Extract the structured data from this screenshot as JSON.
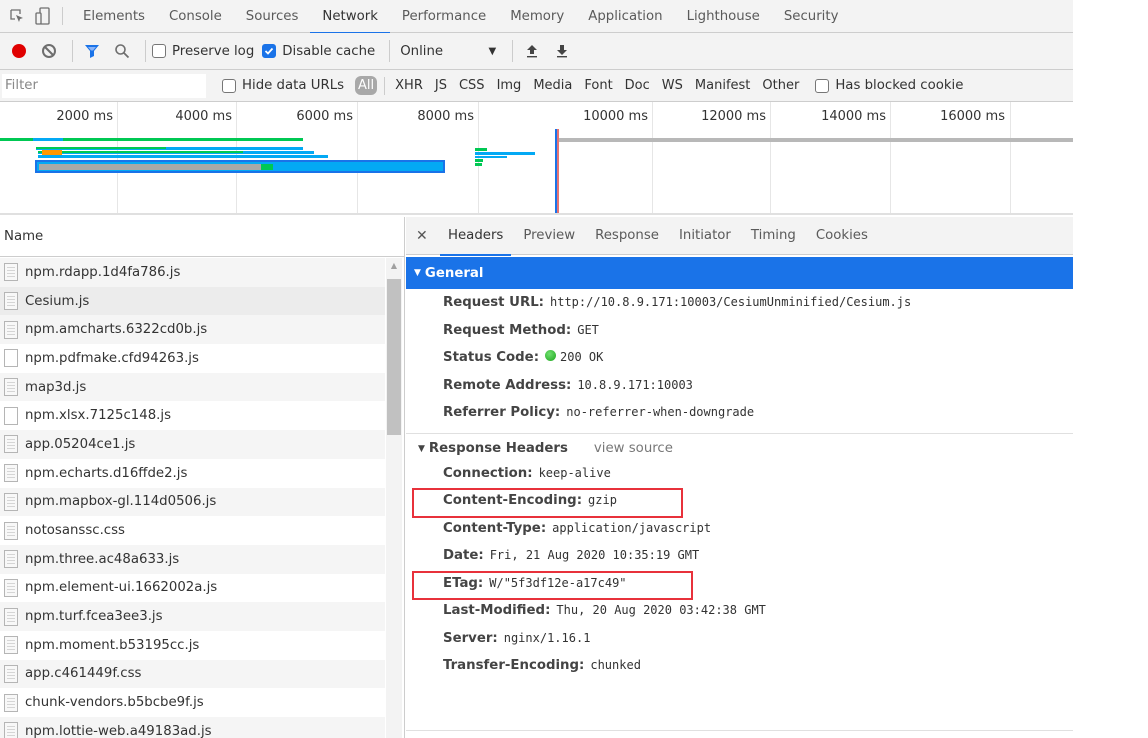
{
  "tabbar": {
    "tabs": [
      {
        "label": "Elements",
        "active": false
      },
      {
        "label": "Console",
        "active": false
      },
      {
        "label": "Sources",
        "active": false
      },
      {
        "label": "Network",
        "active": true
      },
      {
        "label": "Performance",
        "active": false
      },
      {
        "label": "Memory",
        "active": false
      },
      {
        "label": "Application",
        "active": false
      },
      {
        "label": "Lighthouse",
        "active": false
      },
      {
        "label": "Security",
        "active": false
      }
    ],
    "icons": [
      "inspect-element-icon",
      "device-toolbar-icon"
    ]
  },
  "toolbar": {
    "record_color": "#e00000",
    "preserve_log": {
      "label": "Preserve log",
      "checked": false
    },
    "disable_cache": {
      "label": "Disable cache",
      "checked": true
    },
    "throttling": "Online",
    "upload_icon": "import-har-icon",
    "download_icon": "export-har-icon"
  },
  "filterbar": {
    "placeholder": "Filter",
    "hide_data_urls": {
      "label": "Hide data URLs",
      "checked": false
    },
    "types": [
      "All",
      "XHR",
      "JS",
      "CSS",
      "Img",
      "Media",
      "Font",
      "Doc",
      "WS",
      "Manifest",
      "Other"
    ],
    "active_type": "All",
    "blocked_cookies": {
      "label": "Has blocked cookie",
      "checked": false
    }
  },
  "overview": {
    "ticks": [
      "2000 ms",
      "4000 ms",
      "6000 ms",
      "8000 ms",
      "10000 ms",
      "12000 ms",
      "14000 ms",
      "16000 ms"
    ],
    "colors": {
      "waiting": "#00c853",
      "download": "#03a9f4",
      "queued": "#a0a0a0",
      "stalled": "#ff9800",
      "dom_content_loaded": "#1a73e8",
      "load": "#e57373"
    }
  },
  "request_list": {
    "header": "Name",
    "rows": [
      {
        "name": "npm.rdapp.1d4fa786.js",
        "icon": "script",
        "selected": false
      },
      {
        "name": "Cesium.js",
        "icon": "script",
        "selected": true
      },
      {
        "name": "npm.amcharts.6322cd0b.js",
        "icon": "script",
        "selected": false
      },
      {
        "name": "npm.pdfmake.cfd94263.js",
        "icon": "blank",
        "selected": false
      },
      {
        "name": "map3d.js",
        "icon": "script",
        "selected": false
      },
      {
        "name": "npm.xlsx.7125c148.js",
        "icon": "blank",
        "selected": false
      },
      {
        "name": "app.05204ce1.js",
        "icon": "script",
        "selected": false
      },
      {
        "name": "npm.echarts.d16ffde2.js",
        "icon": "script",
        "selected": false
      },
      {
        "name": "npm.mapbox-gl.114d0506.js",
        "icon": "script",
        "selected": false
      },
      {
        "name": "notosanssc.css",
        "icon": "script",
        "selected": false
      },
      {
        "name": "npm.three.ac48a633.js",
        "icon": "script",
        "selected": false
      },
      {
        "name": "npm.element-ui.1662002a.js",
        "icon": "script",
        "selected": false
      },
      {
        "name": "npm.turf.fcea3ee3.js",
        "icon": "script",
        "selected": false
      },
      {
        "name": "npm.moment.b53195cc.js",
        "icon": "script",
        "selected": false
      },
      {
        "name": "app.c461449f.css",
        "icon": "script",
        "selected": false
      },
      {
        "name": "chunk-vendors.b5bcbe9f.js",
        "icon": "script",
        "selected": false
      },
      {
        "name": "npm.lottie-web.a49183ad.js",
        "icon": "script",
        "selected": false
      }
    ]
  },
  "details": {
    "tabs": [
      {
        "label": "Headers",
        "active": true
      },
      {
        "label": "Preview",
        "active": false
      },
      {
        "label": "Response",
        "active": false
      },
      {
        "label": "Initiator",
        "active": false
      },
      {
        "label": "Timing",
        "active": false
      },
      {
        "label": "Cookies",
        "active": false
      }
    ],
    "general": {
      "title": "General",
      "fields": [
        {
          "key": "Request URL:",
          "value": "http://10.8.9.171:10003/CesiumUnminified/Cesium.js"
        },
        {
          "key": "Request Method:",
          "value": "GET"
        },
        {
          "key": "Status Code:",
          "value": "200 OK",
          "status_dot": "#1ea51e"
        },
        {
          "key": "Remote Address:",
          "value": "10.8.9.171:10003"
        },
        {
          "key": "Referrer Policy:",
          "value": "no-referrer-when-downgrade"
        }
      ]
    },
    "response_headers": {
      "title": "Response Headers",
      "view_source": "view source",
      "fields": [
        {
          "key": "Connection:",
          "value": "keep-alive",
          "highlighted": false
        },
        {
          "key": "Content-Encoding:",
          "value": "gzip",
          "highlighted": true
        },
        {
          "key": "Content-Type:",
          "value": "application/javascript",
          "highlighted": false
        },
        {
          "key": "Date:",
          "value": "Fri, 21 Aug 2020 10:35:19 GMT",
          "highlighted": false
        },
        {
          "key": "ETag:",
          "value": "W/\"5f3df12e-a17c49\"",
          "highlighted": true
        },
        {
          "key": "Last-Modified:",
          "value": "Thu, 20 Aug 2020 03:42:38 GMT",
          "highlighted": false
        },
        {
          "key": "Server:",
          "value": "nginx/1.16.1",
          "highlighted": false
        },
        {
          "key": "Transfer-Encoding:",
          "value": "chunked",
          "highlighted": false
        }
      ]
    },
    "highlight_color": "#e8313b"
  }
}
